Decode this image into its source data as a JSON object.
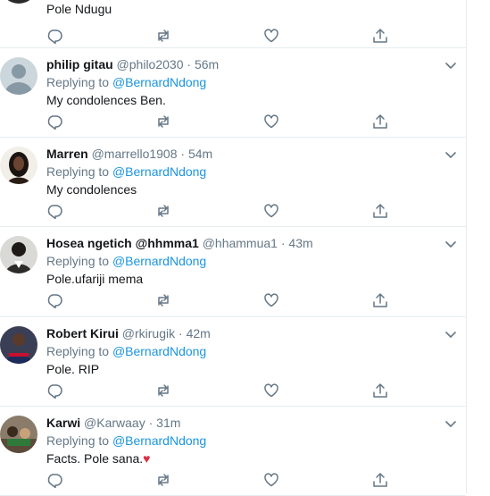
{
  "tweets": [
    {
      "name": "",
      "handle": "",
      "time": "",
      "replying_prefix": "",
      "replying_to": "",
      "text": "Pole Ndugu"
    },
    {
      "name": "philip gitau",
      "handle": "@philo2030",
      "time": "56m",
      "replying_prefix": "Replying to",
      "replying_to": "@BernardNdong",
      "text": "My condolences Ben."
    },
    {
      "name": "Marren",
      "handle": "@marrello1908",
      "time": "54m",
      "replying_prefix": "Replying to",
      "replying_to": "@BernardNdong",
      "text": "My condolences"
    },
    {
      "name": "Hosea ngetich @hhmma1",
      "handle": "@hhammua1",
      "time": "43m",
      "replying_prefix": "Replying to",
      "replying_to": "@BernardNdong",
      "text": "Pole.ufariji mema"
    },
    {
      "name": "Robert Kirui",
      "handle": "@rkirugik",
      "time": "42m",
      "replying_prefix": "Replying to",
      "replying_to": "@BernardNdong",
      "text": "Pole. RIP"
    },
    {
      "name": "Karwi",
      "handle": "@Karwaay",
      "time": "31m",
      "replying_prefix": "Replying to",
      "replying_to": "@BernardNdong",
      "text": "Facts. Pole sana.",
      "emoji": "♥"
    }
  ],
  "separator": "·",
  "colors": {
    "link": "#1b95e0",
    "muted": "#657786",
    "icon": "#657786",
    "border": "#e6ecf0",
    "heart_emoji": "#dd2e44"
  },
  "icons": {
    "reply": "reply-icon",
    "retweet": "retweet-icon",
    "like": "like-icon",
    "share": "share-icon",
    "menu": "chevron-down-icon"
  }
}
